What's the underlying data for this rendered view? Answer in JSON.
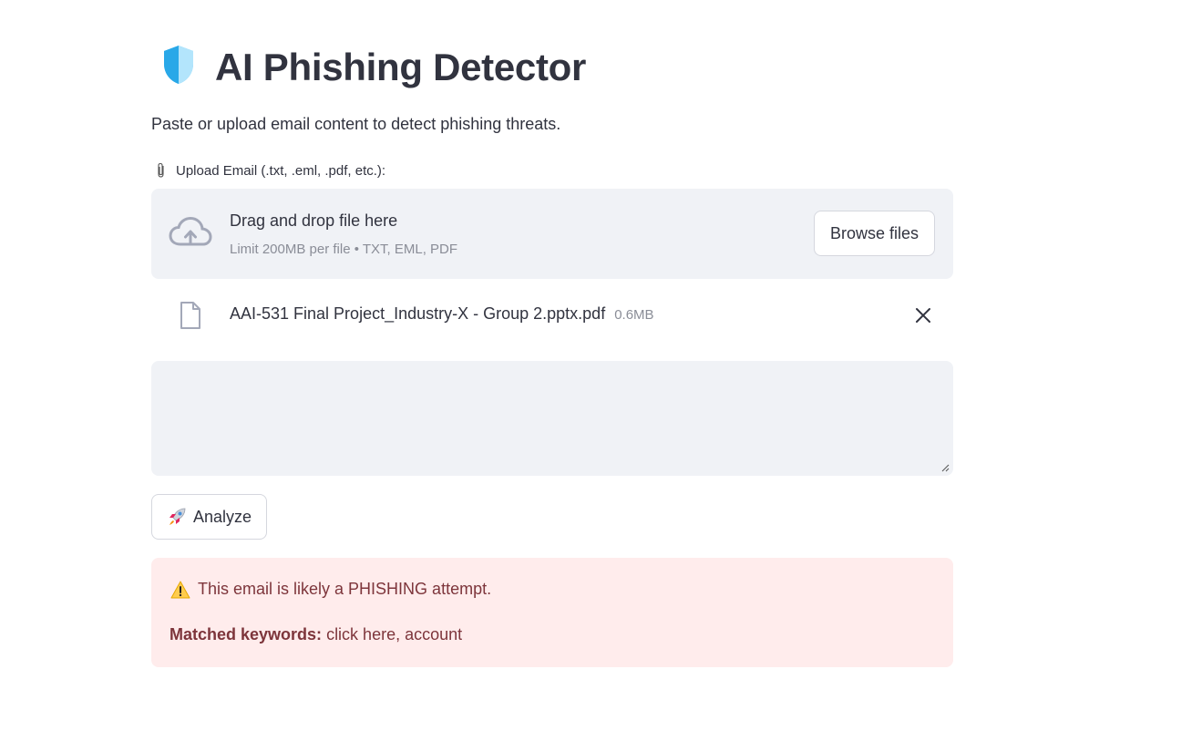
{
  "header": {
    "title": "AI Phishing Detector",
    "icon": "shield-icon",
    "subtitle": "Paste or upload email content to detect phishing threats."
  },
  "upload": {
    "label": "Upload Email (.txt, .eml, .pdf, etc.):",
    "label_icon": "paperclip-icon",
    "dropzone_title": "Drag and drop file here",
    "dropzone_limit": "Limit 200MB per file • TXT, EML, PDF",
    "browse_label": "Browse files",
    "file": {
      "name": "AAI-531 Final Project_Industry-X - Group 2.pptx.pdf",
      "size": "0.6MB"
    }
  },
  "email_input": {
    "value": ""
  },
  "actions": {
    "analyze_label": "Analyze",
    "analyze_icon": "rocket-icon"
  },
  "result": {
    "message": "This email is likely a PHISHING attempt.",
    "keywords_label": "Matched keywords:",
    "keywords": "click here, account"
  },
  "colors": {
    "alert_bg": "#ffecec",
    "alert_text": "#7d353b",
    "input_bg": "#f0f2f6",
    "text": "#31333f"
  }
}
